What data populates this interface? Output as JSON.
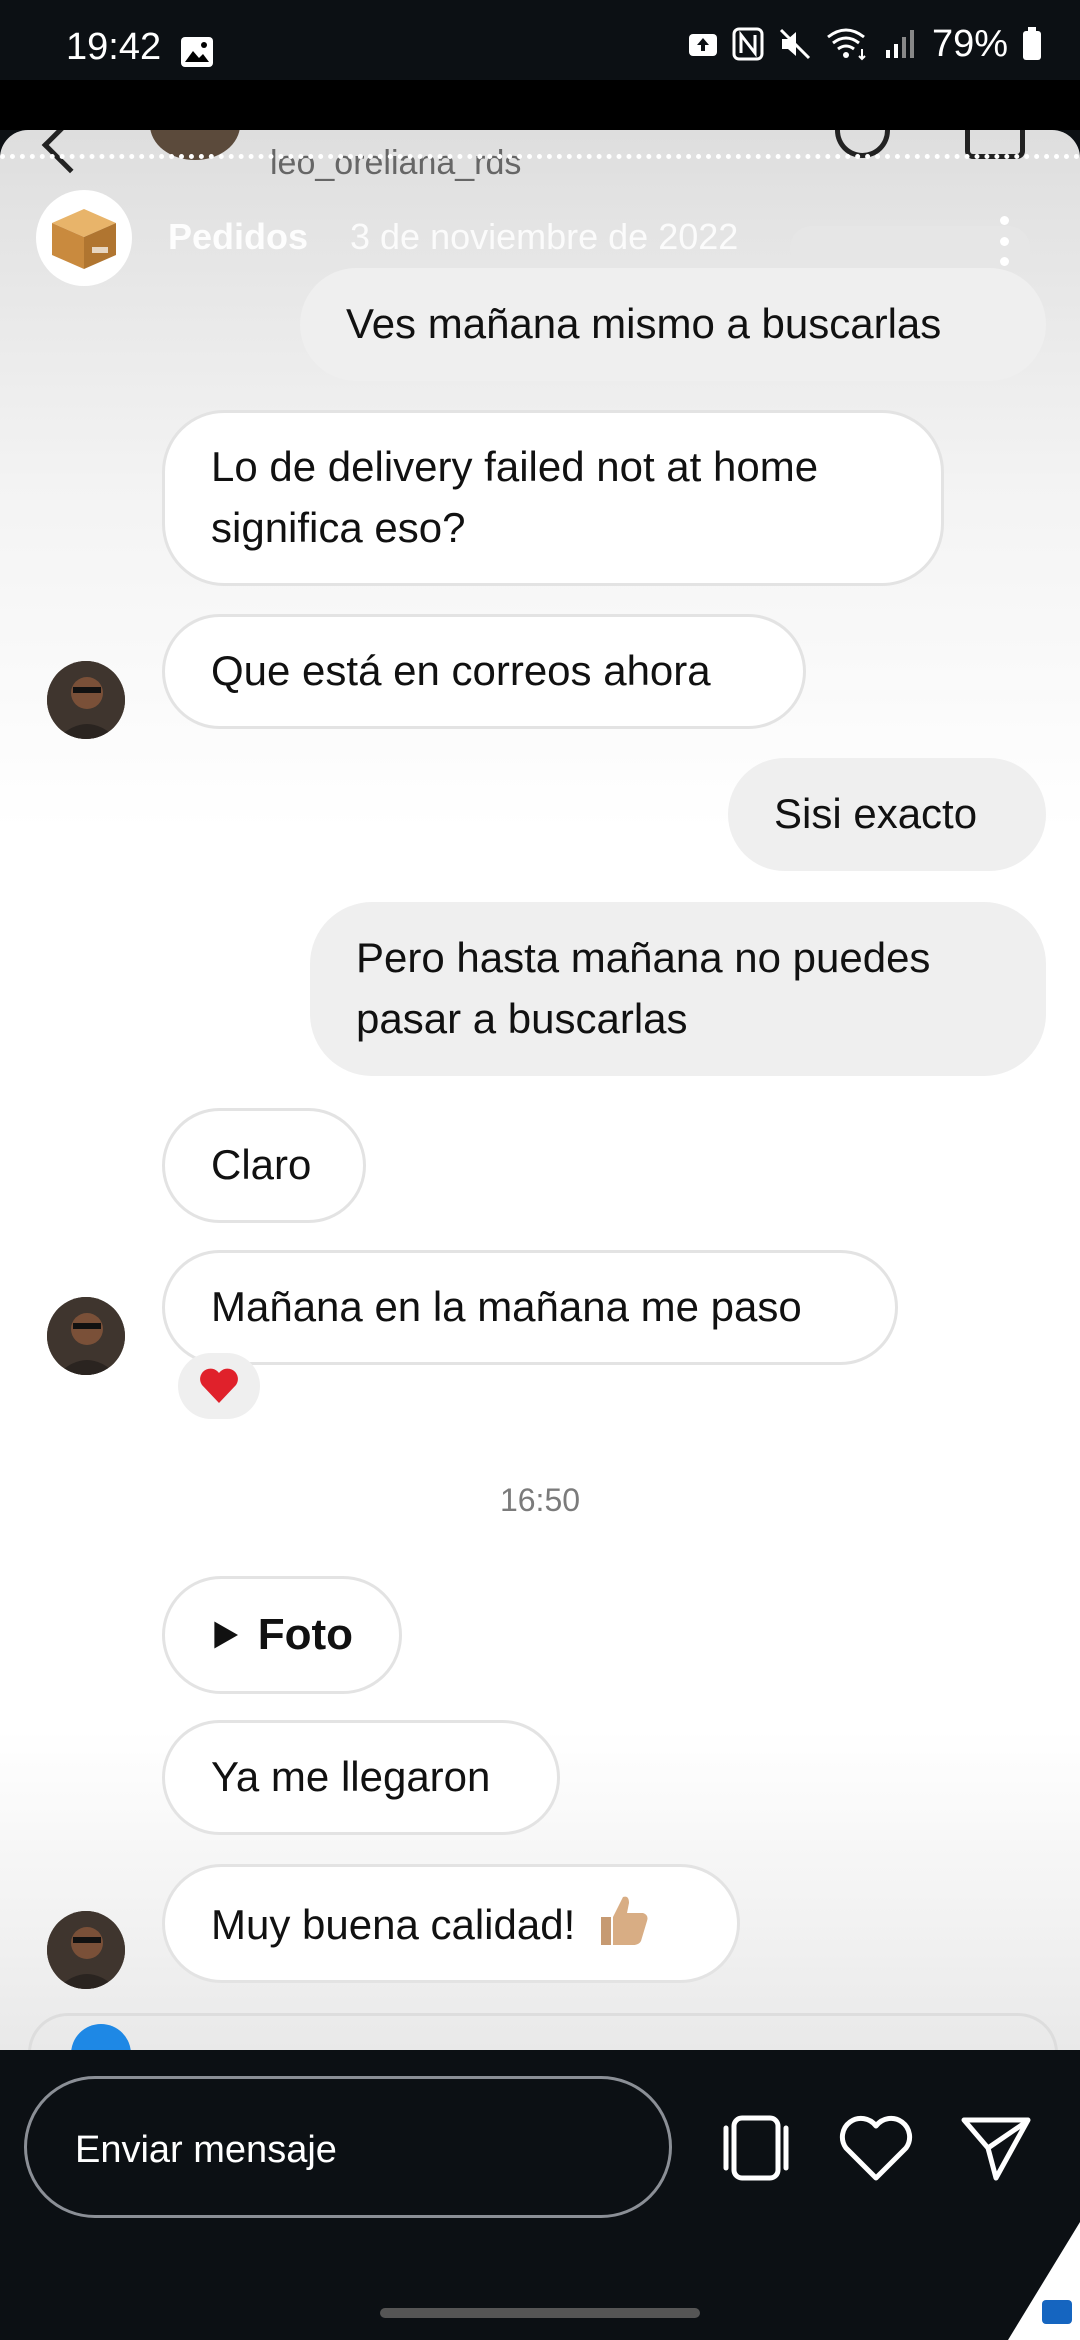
{
  "status": {
    "time": "19:42",
    "battery": "79%"
  },
  "header": {
    "username": "leo_oreliana_rds"
  },
  "story": {
    "label": "Pedidos",
    "date": "3 de noviembre de 2022"
  },
  "messages": [
    {
      "dir": "out",
      "text": "Ves mañana mismo a buscarlas"
    },
    {
      "dir": "in",
      "text": "Lo de delivery failed not at home significa eso?"
    },
    {
      "dir": "in",
      "text": "Que está en correos ahora"
    },
    {
      "dir": "out",
      "text": "Sisi exacto"
    },
    {
      "dir": "out",
      "text": "Pero hasta mañana no puedes pasar a buscarlas"
    },
    {
      "dir": "in",
      "text": "Claro"
    },
    {
      "dir": "in",
      "text": "Mañana en la mañana me paso",
      "reaction": "heart"
    },
    {
      "dir": "in",
      "text": "Foto",
      "type": "media"
    },
    {
      "dir": "in",
      "text": "Ya me llegaron"
    },
    {
      "dir": "in",
      "text": "Muy buena calidad!",
      "emoji": "thumbs-up"
    }
  ],
  "timestamp": "16:50",
  "composer": {
    "placeholder": "Enviar mensaje"
  },
  "icons": [
    "image-icon",
    "upload-icon",
    "nfc-icon",
    "mute-icon",
    "wifi-icon",
    "signal-icon",
    "battery-icon",
    "back-icon",
    "phone-icon",
    "video-icon",
    "more-icon",
    "play-icon",
    "heart-icon",
    "send-icon",
    "reels-icon",
    "thumbs-up-icon"
  ]
}
